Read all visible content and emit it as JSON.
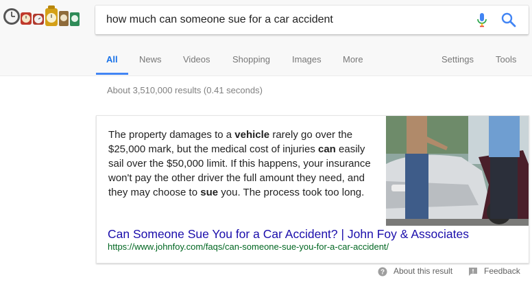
{
  "search": {
    "query": "how much can someone sue for a car accident"
  },
  "tabs": [
    {
      "label": "All",
      "active": true
    },
    {
      "label": "News"
    },
    {
      "label": "Videos"
    },
    {
      "label": "Shopping"
    },
    {
      "label": "Images"
    },
    {
      "label": "More"
    },
    {
      "label": "Settings"
    },
    {
      "label": "Tools"
    }
  ],
  "stats": "About 3,510,000 results (0.41 seconds)",
  "snippet": {
    "parts": [
      {
        "text": "The property damages to a ",
        "bold": false
      },
      {
        "text": "vehicle",
        "bold": true
      },
      {
        "text": " rarely go over the $25,000 mark, but the medical cost of injuries ",
        "bold": false
      },
      {
        "text": "can",
        "bold": true
      },
      {
        "text": " easily sail over the $50,000 limit. If this happens, your insurance won't pay the other driver the full amount they need, and they may choose to ",
        "bold": false
      },
      {
        "text": "sue",
        "bold": true
      },
      {
        "text": " you. The process took too long.",
        "bold": false
      }
    ],
    "title": "Can Someone Sue You for a Car Accident? | John Foy & Associates",
    "url": "https://www.johnfoy.com/faqs/can-someone-sue-you-for-a-car-accident/"
  },
  "footer": {
    "about": "About this result",
    "feedback": "Feedback"
  },
  "colors": {
    "accent": "#4285f4",
    "link": "#1a0dab",
    "url": "#006621"
  }
}
